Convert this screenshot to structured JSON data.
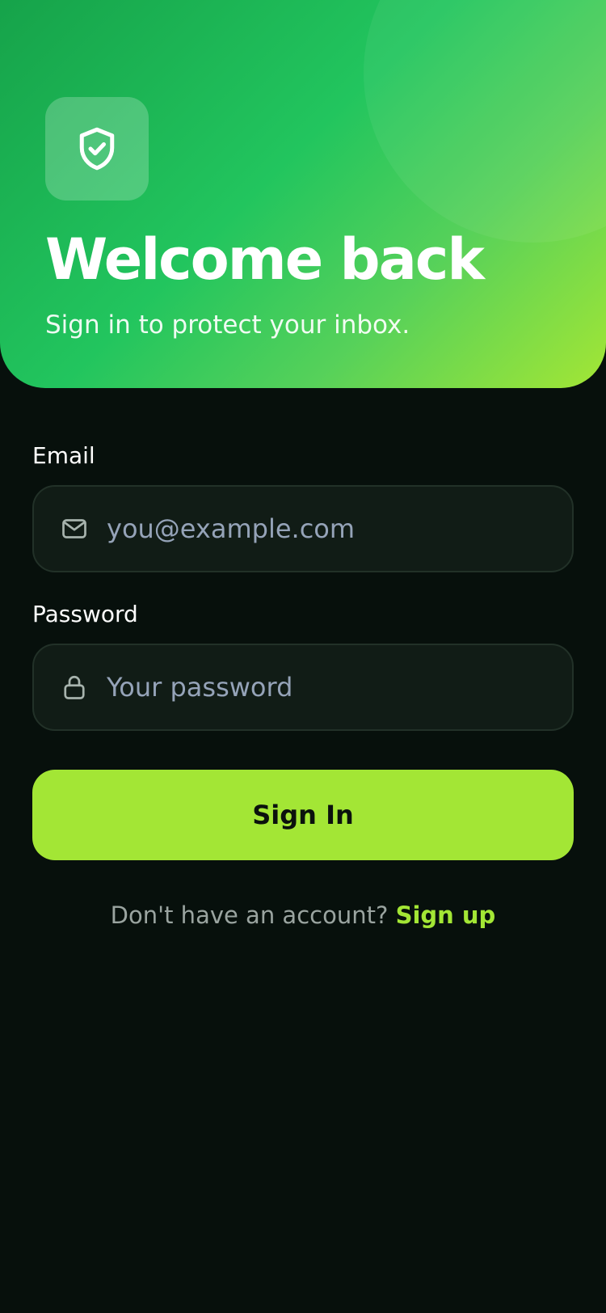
{
  "header": {
    "title": "Welcome back",
    "subtitle": "Sign in to protect your inbox.",
    "icon": "shield-check-icon"
  },
  "form": {
    "email": {
      "label": "Email",
      "placeholder": "you@example.com",
      "value": "",
      "icon": "mail-icon"
    },
    "password": {
      "label": "Password",
      "placeholder": "Your password",
      "value": "",
      "icon": "lock-icon"
    },
    "submit_label": "Sign In"
  },
  "footer": {
    "prompt": "Don't have an account?",
    "link_label": "Sign up"
  },
  "colors": {
    "background": "#07100c",
    "hero_gradient_start": "#16a34a",
    "hero_gradient_end": "#a3e635",
    "accent": "#a3e635",
    "field_background": "#111c16",
    "field_border": "#223128",
    "placeholder": "#95a3b8",
    "muted_text": "#9aa4a0"
  }
}
